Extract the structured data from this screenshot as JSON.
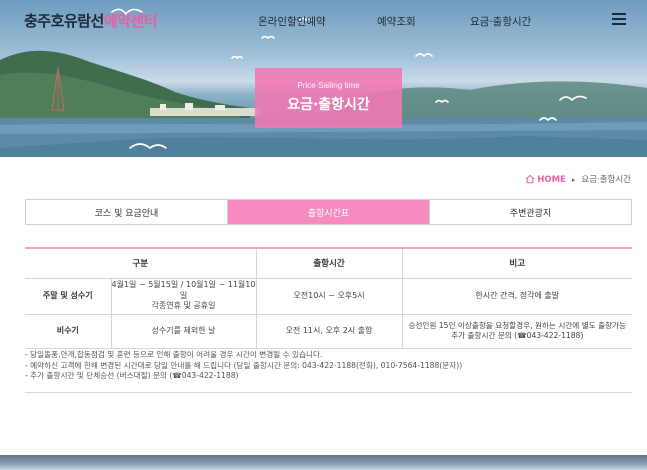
{
  "header": {
    "logo_main": "충주호유람선",
    "logo_accent": "예약센터",
    "nav": [
      "온라인할인예약",
      "예약조회",
      "요금·출항시간"
    ],
    "menu_icon": "hamburger-menu-icon"
  },
  "hero": {
    "subtitle": "Price·Sailing time",
    "title": "요금·출항시간"
  },
  "breadcrumb": {
    "home": "HOME",
    "current": "요금·출항시간",
    "home_icon": "home-icon",
    "accent_color": "#ec5fa4"
  },
  "tabs": [
    {
      "label": "코스 및 요금안내",
      "active": false
    },
    {
      "label": "출항시간표",
      "active": true
    },
    {
      "label": "주변관광지",
      "active": false
    }
  ],
  "table": {
    "headers": [
      "구분",
      "출항시간",
      "비고"
    ],
    "rows": [
      {
        "category": "주말 및 성수기",
        "period_line1": "4월1일 ~ 5월15일 / 10월1일 ~ 11월10일",
        "period_line2": "각종연휴 및 공휴일",
        "time": "오전10시 ~ 오후5시",
        "note_line1": "한시간 간격, 정각에 출발",
        "note_line2": ""
      },
      {
        "category": "비수기",
        "period_line1": "성수기를 제외한 날",
        "period_line2": "",
        "time": "오전 11시, 오후 2시 출항",
        "note_line1": "승선인원 15인 이상출항을 요청할경우, 원하는 시간에 별도 출항가능",
        "note_line2": "추가 출항시간 문의 (☎043-422-1188)"
      }
    ]
  },
  "notes": [
    "- 당일돌풍,안개,합동점검 및 훈련 등으로 인해 출항이 어려울 경우 시간이 변경될 수 있습니다.",
    "- 예약하신 고객에 한해 변경된 시간대로 당일 안내를 해 드립니다 (당일 출항시간 문의: 043-422-1188(전화), 010-7564-1188(문자))",
    "- 추가 출항시간 및 단체승선 (버스대절) 문의 (☎043-422-1188)"
  ],
  "colors": {
    "accent_pink": "#f78bbf",
    "title_box": "#f378b4",
    "table_top_border": "#f7a2ca"
  }
}
